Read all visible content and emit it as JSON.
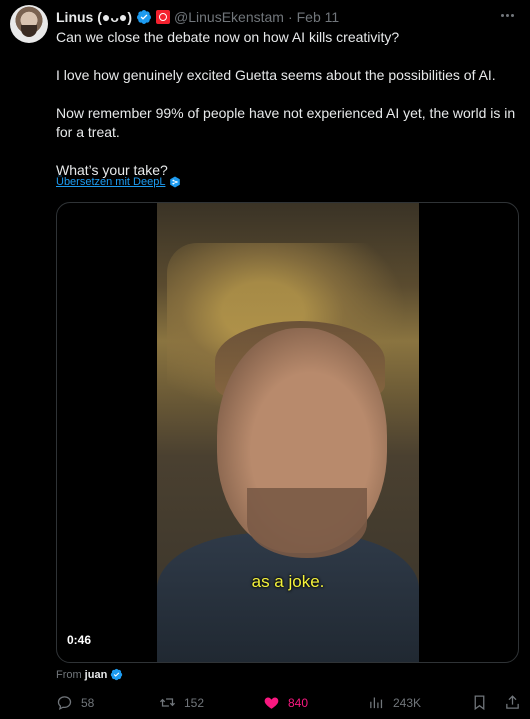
{
  "tweet": {
    "author_name": "Linus (●ᴗ●)",
    "handle": "@LinusEkenstam",
    "separator": "·",
    "date": "Feb 11",
    "paragraphs": [
      "Can we close the debate now on how AI kills creativity?",
      "I love how genuinely excited Guetta seems about the possibilities of AI.",
      "Now remember 99% of people have not experienced AI yet, the world is in for a treat.",
      "What’s your take?"
    ],
    "translate_label": "Übersetzen mit DeepL"
  },
  "media": {
    "caption": "as a joke.",
    "duration": "0:46"
  },
  "source": {
    "from_label": "From",
    "from_name": "juan"
  },
  "actions": {
    "replies": "58",
    "reposts": "152",
    "likes": "840",
    "views": "243K"
  },
  "colors": {
    "accent": "#1d9bf0",
    "like": "#f91880",
    "muted": "#71767b",
    "caption": "#f4f23a"
  },
  "icons": [
    "verified-icon",
    "affiliate-badge-icon",
    "more-icon",
    "deepl-icon",
    "reply-icon",
    "repost-icon",
    "like-icon",
    "views-icon",
    "bookmark-icon",
    "share-icon"
  ]
}
